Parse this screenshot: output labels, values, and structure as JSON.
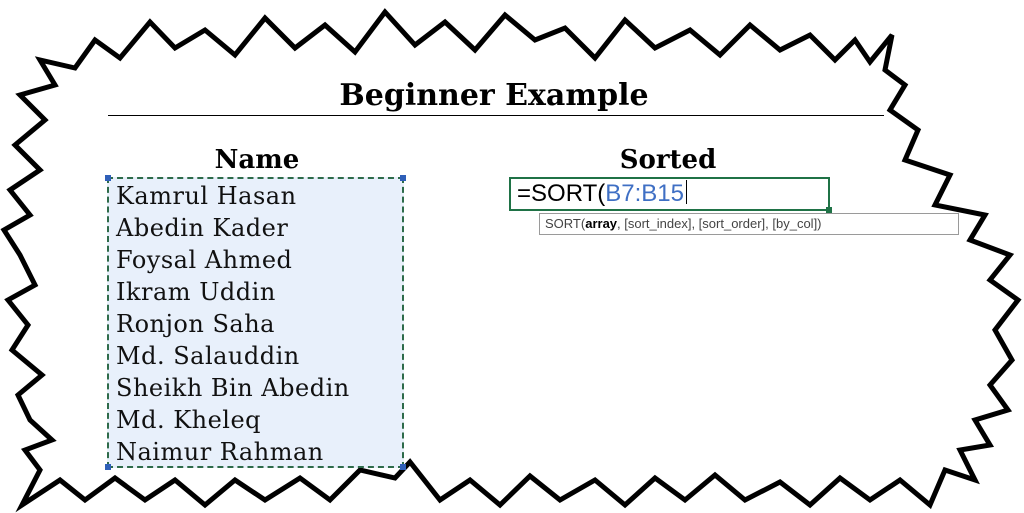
{
  "title": "Beginner Example",
  "columns": {
    "name_header": "Name",
    "sorted_header": "Sorted"
  },
  "names": [
    "Kamrul Hasan",
    "Abedin Kader",
    "Foysal Ahmed",
    "Ikram Uddin",
    "Ronjon Saha",
    "Md. Salauddin",
    "Sheikh Bin Abedin",
    "Md. Kheleq",
    "Naimur Rahman"
  ],
  "formula": {
    "prefix": "=SORT(",
    "range_ref": "B7:B15"
  },
  "tooltip": {
    "fn": "SORT(",
    "arg_active": "array",
    "rest": ", [sort_index], [sort_order], [by_col])"
  },
  "colors": {
    "selection_fill": "#e8f0fb",
    "selection_border": "#2e6b4a",
    "active_cell_border": "#1f7246",
    "range_ref_color": "#3f6fc4"
  }
}
